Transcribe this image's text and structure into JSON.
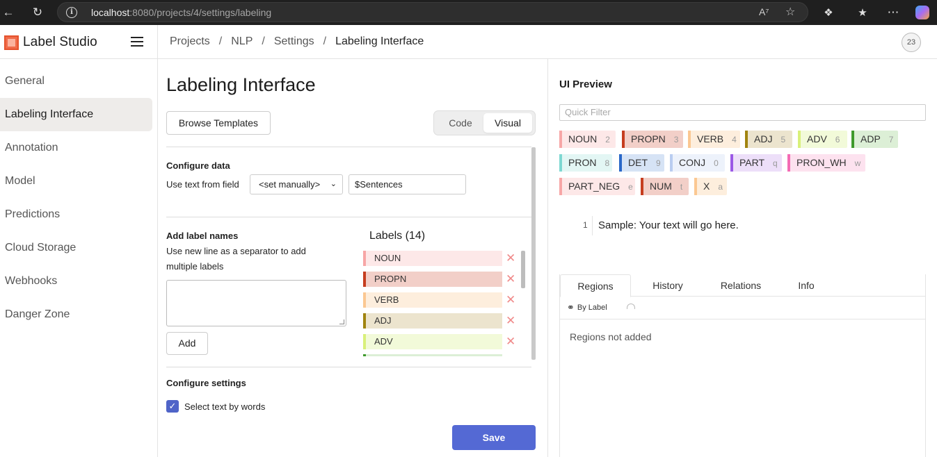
{
  "browser": {
    "url_host": "localhost",
    "url_rest": ":8080/projects/4/settings/labeling"
  },
  "app": {
    "name": "Label Studio",
    "breadcrumb": [
      "Projects",
      "NLP",
      "Settings",
      "Labeling Interface"
    ],
    "user_initials": "23"
  },
  "sidebar": {
    "items": [
      {
        "label": "General",
        "active": false
      },
      {
        "label": "Labeling Interface",
        "active": true
      },
      {
        "label": "Annotation",
        "active": false
      },
      {
        "label": "Model",
        "active": false
      },
      {
        "label": "Predictions",
        "active": false
      },
      {
        "label": "Cloud Storage",
        "active": false
      },
      {
        "label": "Webhooks",
        "active": false
      },
      {
        "label": "Danger Zone",
        "active": false
      }
    ]
  },
  "config": {
    "title": "Labeling Interface",
    "browse_templates": "Browse Templates",
    "tab_code": "Code",
    "tab_visual": "Visual",
    "configure_data_heading": "Configure data",
    "use_text_label": "Use text from field",
    "field_select_value": "<set manually>",
    "field_input_value": "$Sentences",
    "add_label_heading": "Add label names",
    "add_label_help_1": "Use new line as a separator to add",
    "add_label_help_2": "multiple labels",
    "add_button": "Add",
    "labels_title": "Labels (14)",
    "labels": [
      {
        "name": "NOUN",
        "color": "#f7a6a6",
        "bg": "#fde8e8"
      },
      {
        "name": "PROPN",
        "color": "#c63d1f",
        "bg": "#f2cfc8"
      },
      {
        "name": "VERB",
        "color": "#fbc892",
        "bg": "#fdeedd"
      },
      {
        "name": "ADJ",
        "color": "#a08410",
        "bg": "#ece4ce"
      },
      {
        "name": "ADV",
        "color": "#d9f07a",
        "bg": "#f2fad9"
      }
    ],
    "configure_settings_heading": "Configure settings",
    "select_by_words": "Select text by words",
    "save_button": "Save"
  },
  "preview": {
    "title": "UI Preview",
    "quick_filter_placeholder": "Quick Filter",
    "labels": [
      {
        "name": "NOUN",
        "hotkey": "2",
        "color": "#f7a6a6",
        "bg": "#fde8e8"
      },
      {
        "name": "PROPN",
        "hotkey": "3",
        "color": "#c63d1f",
        "bg": "#f2cfc8"
      },
      {
        "name": "VERB",
        "hotkey": "4",
        "color": "#fbc892",
        "bg": "#fdeedd"
      },
      {
        "name": "ADJ",
        "hotkey": "5",
        "color": "#a08410",
        "bg": "#ece4ce"
      },
      {
        "name": "ADV",
        "hotkey": "6",
        "color": "#d9f07a",
        "bg": "#f2fad9"
      },
      {
        "name": "ADP",
        "hotkey": "7",
        "color": "#3f9a2c",
        "bg": "#dcefd6"
      },
      {
        "name": "PRON",
        "hotkey": "8",
        "color": "#7ed8d2",
        "bg": "#e3f6f4"
      },
      {
        "name": "DET",
        "hotkey": "9",
        "color": "#2a68c8",
        "bg": "#d6e3f5"
      },
      {
        "name": "CONJ",
        "hotkey": "0",
        "color": "#b9cdf0",
        "bg": "#edf2fb"
      },
      {
        "name": "PART",
        "hotkey": "q",
        "color": "#9b59e6",
        "bg": "#eddff9"
      },
      {
        "name": "PRON_WH",
        "hotkey": "w",
        "color": "#f46bb4",
        "bg": "#fde2ef"
      },
      {
        "name": "PART_NEG",
        "hotkey": "e",
        "color": "#f7a6a6",
        "bg": "#fde8e8"
      },
      {
        "name": "NUM",
        "hotkey": "t",
        "color": "#c63d1f",
        "bg": "#f2cfc8"
      },
      {
        "name": "X",
        "hotkey": "a",
        "color": "#fbc892",
        "bg": "#fdeedd"
      }
    ],
    "sample_line_number": "1",
    "sample_text": "Sample: Your text will go here.",
    "tabs": [
      "Regions",
      "History",
      "Relations",
      "Info"
    ],
    "by_label": "By Label",
    "empty_regions": "Regions not added"
  }
}
